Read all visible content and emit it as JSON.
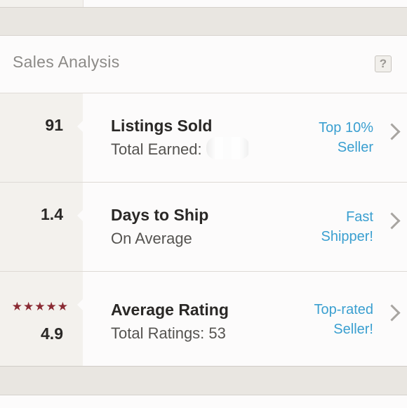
{
  "card": {
    "title": "Sales Analysis",
    "help_glyph": "?"
  },
  "rows": [
    {
      "value": "91",
      "title": "Listings Sold",
      "subtitle": "Total Earned:",
      "badge_line1": "Top 10%",
      "badge_line2": "Seller"
    },
    {
      "value": "1.4",
      "title": "Days to Ship",
      "subtitle": "On Average",
      "badge_line1": "Fast",
      "badge_line2": "Shipper!"
    },
    {
      "value": "4.9",
      "stars": "★★★★★",
      "rating_out_of_5": 4.9,
      "title": "Average Rating",
      "subtitle": "Total Ratings: 53",
      "badge_line1": "Top-rated",
      "badge_line2": "Seller!"
    }
  ],
  "colors": {
    "accent_link": "#3a9fd0",
    "star": "#8a2a33",
    "background": "#e9e6e1"
  },
  "icons": [
    "help-icon",
    "chevron-right-icon",
    "star-icon"
  ]
}
